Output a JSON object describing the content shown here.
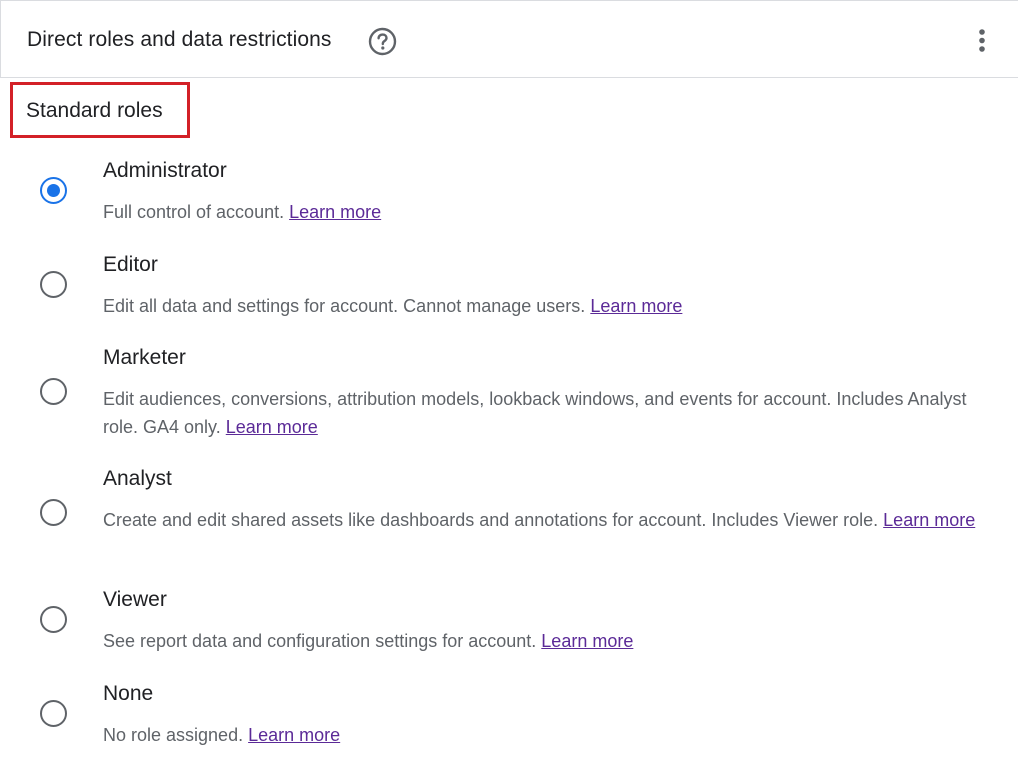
{
  "header": {
    "title": "Direct roles and data restrictions",
    "help_icon": "help-circle-icon",
    "menu_icon": "more-vert-icon"
  },
  "section": {
    "title": "Standard roles"
  },
  "roles": [
    {
      "name": "Administrator",
      "description": "Full control of account.",
      "link": "Learn more",
      "selected": true
    },
    {
      "name": "Editor",
      "description": "Edit all data and settings for account. Cannot manage users.",
      "link": "Learn more",
      "selected": false
    },
    {
      "name": "Marketer",
      "description": "Edit audiences, conversions, attribution models, lookback windows, and events for account. Includes Analyst role. GA4 only.",
      "link": "Learn more",
      "selected": false
    },
    {
      "name": "Analyst",
      "description": "Create and edit shared assets like dashboards and annotations for account. Includes Viewer role.",
      "link": "Learn more",
      "selected": false
    },
    {
      "name": "Viewer",
      "description": "See report data and configuration settings for account.",
      "link": "Learn more",
      "selected": false
    },
    {
      "name": "None",
      "description": "No role assigned.",
      "link": "Learn more",
      "selected": false
    }
  ],
  "colors": {
    "accent": "#1a73e8",
    "highlight_box": "#d32027",
    "link": "#5b2a97",
    "text_secondary": "#5f6368"
  }
}
